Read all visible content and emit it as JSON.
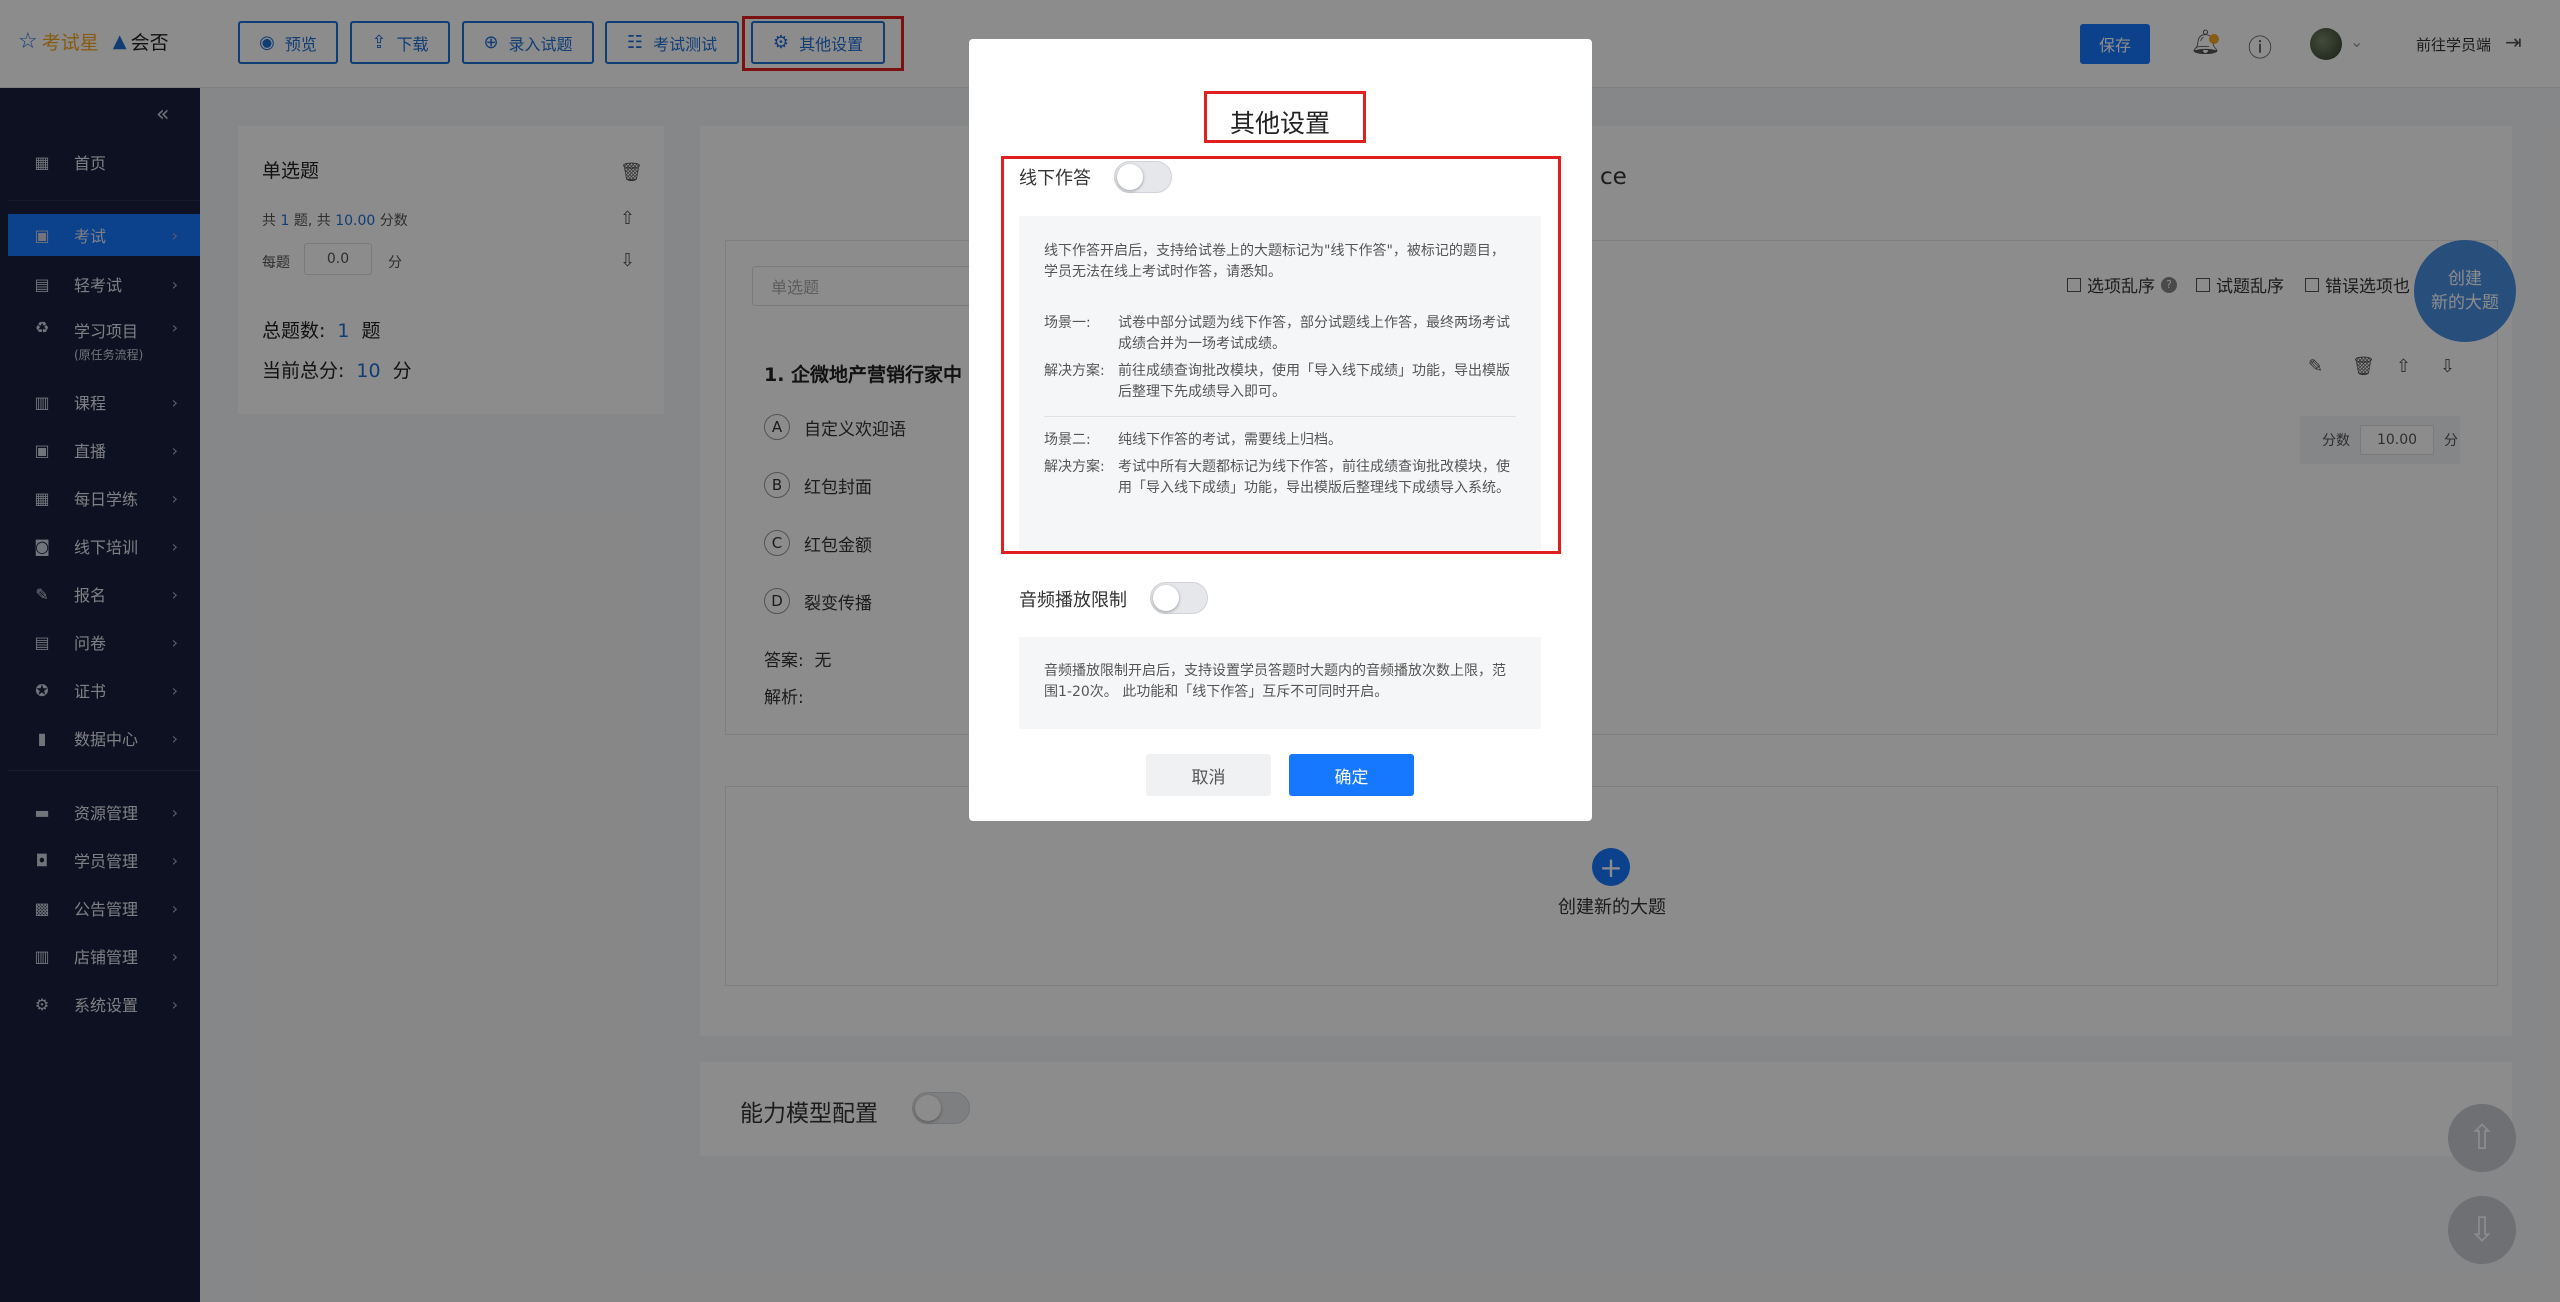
{
  "header": {
    "logo_primary": "考试星",
    "logo_secondary": "会否",
    "buttons": [
      {
        "label": "预览",
        "icon": "eye-icon"
      },
      {
        "label": "下载",
        "icon": "upload-icon"
      },
      {
        "label": "录入试题",
        "icon": "plus-circle-icon"
      },
      {
        "label": "考试测试",
        "icon": "list-icon"
      },
      {
        "label": "其他设置",
        "icon": "gear-icon"
      }
    ],
    "save_label": "保存",
    "goto_student": "前往学员端"
  },
  "sidebar": {
    "items": [
      {
        "label": "首页",
        "icon": "grid-icon"
      },
      {
        "label": "考试",
        "icon": "exam-icon",
        "active": true
      },
      {
        "label": "轻考试",
        "icon": "light-exam-icon"
      },
      {
        "label": "学习项目",
        "sub": "(原任务流程)",
        "icon": "project-icon"
      },
      {
        "label": "课程",
        "icon": "book-icon"
      },
      {
        "label": "直播",
        "icon": "live-icon"
      },
      {
        "label": "每日学练",
        "icon": "calendar-icon"
      },
      {
        "label": "线下培训",
        "icon": "training-icon"
      },
      {
        "label": "报名",
        "icon": "signup-icon"
      },
      {
        "label": "问卷",
        "icon": "survey-icon"
      },
      {
        "label": "证书",
        "icon": "certificate-icon"
      },
      {
        "label": "数据中心",
        "icon": "chart-icon"
      },
      {
        "label": "资源管理",
        "icon": "folder-icon"
      },
      {
        "label": "学员管理",
        "icon": "user-icon"
      },
      {
        "label": "公告管理",
        "icon": "notice-icon"
      },
      {
        "label": "店铺管理",
        "icon": "shop-icon"
      },
      {
        "label": "系统设置",
        "icon": "gear-icon"
      }
    ]
  },
  "left_panel": {
    "title": "单选题",
    "gong": "共",
    "count": "1",
    "ti_gong": "题, 共",
    "points": "10.00",
    "fenshu": "分数",
    "each_label": "每题",
    "each_value": "0.0",
    "each_unit": "分",
    "total_label": "总题数:",
    "total_value": "1",
    "total_unit": "题",
    "score_label": "当前总分:",
    "score_value": "10",
    "score_unit": "分"
  },
  "main": {
    "title_tail": "ce",
    "type_placeholder": "单选题",
    "options_shuffle": "选项乱序",
    "questions_shuffle": "试题乱序",
    "wrong_option": "错误选项也",
    "question_title": "1. 企微地产营销行家中",
    "choices": [
      {
        "letter": "A",
        "text": "自定义欢迎语"
      },
      {
        "letter": "B",
        "text": "红包封面"
      },
      {
        "letter": "C",
        "text": "红包金额"
      },
      {
        "letter": "D",
        "text": "裂变传播"
      }
    ],
    "answer_label": "答案:",
    "answer_value": "无",
    "analysis_label": "解析:",
    "score_label": "分数",
    "score_value": "10.00",
    "score_unit": "分",
    "new_section_label": "创建新的大题",
    "ability_label": "能力模型配置",
    "fab_create_line1": "创建",
    "fab_create_line2": "新的大题"
  },
  "modal": {
    "title": "其他设置",
    "offline_label": "线下作答",
    "offline_enabled": false,
    "offline_desc": "线下作答开启后，支持给试卷上的大题标记为\"线下作答\"，被标记的题目，学员无法在线上考试时作答，请悉知。",
    "scene1_key": "场景一:",
    "scene1_value": "试卷中部分试题为线下作答，部分试题线上作答，最终两场考试成绩合并为一场考试成绩。",
    "solution1_key": "解决方案:",
    "solution1_value": "前往成绩查询批改模块，使用「导入线下成绩」功能，导出模版后整理下先成绩导入即可。",
    "scene2_key": "场景二:",
    "scene2_value": "纯线下作答的考试，需要线上归档。",
    "solution2_key": "解决方案:",
    "solution2_value": "考试中所有大题都标记为线下作答，前往成绩查询批改模块，使用「导入线下成绩」功能，导出模版后整理线下成绩导入系统。",
    "audio_label": "音频播放限制",
    "audio_enabled": false,
    "audio_desc": "音频播放限制开启后，支持设置学员答题时大题内的音频播放次数上限，范围1-20次。 此功能和「线下作答」互斥不可同时开启。",
    "cancel_label": "取消",
    "ok_label": "确定"
  },
  "colors": {
    "primary": "#1677ff",
    "sidebar_bg": "#1a1f3c",
    "highlight": "#e02020"
  }
}
